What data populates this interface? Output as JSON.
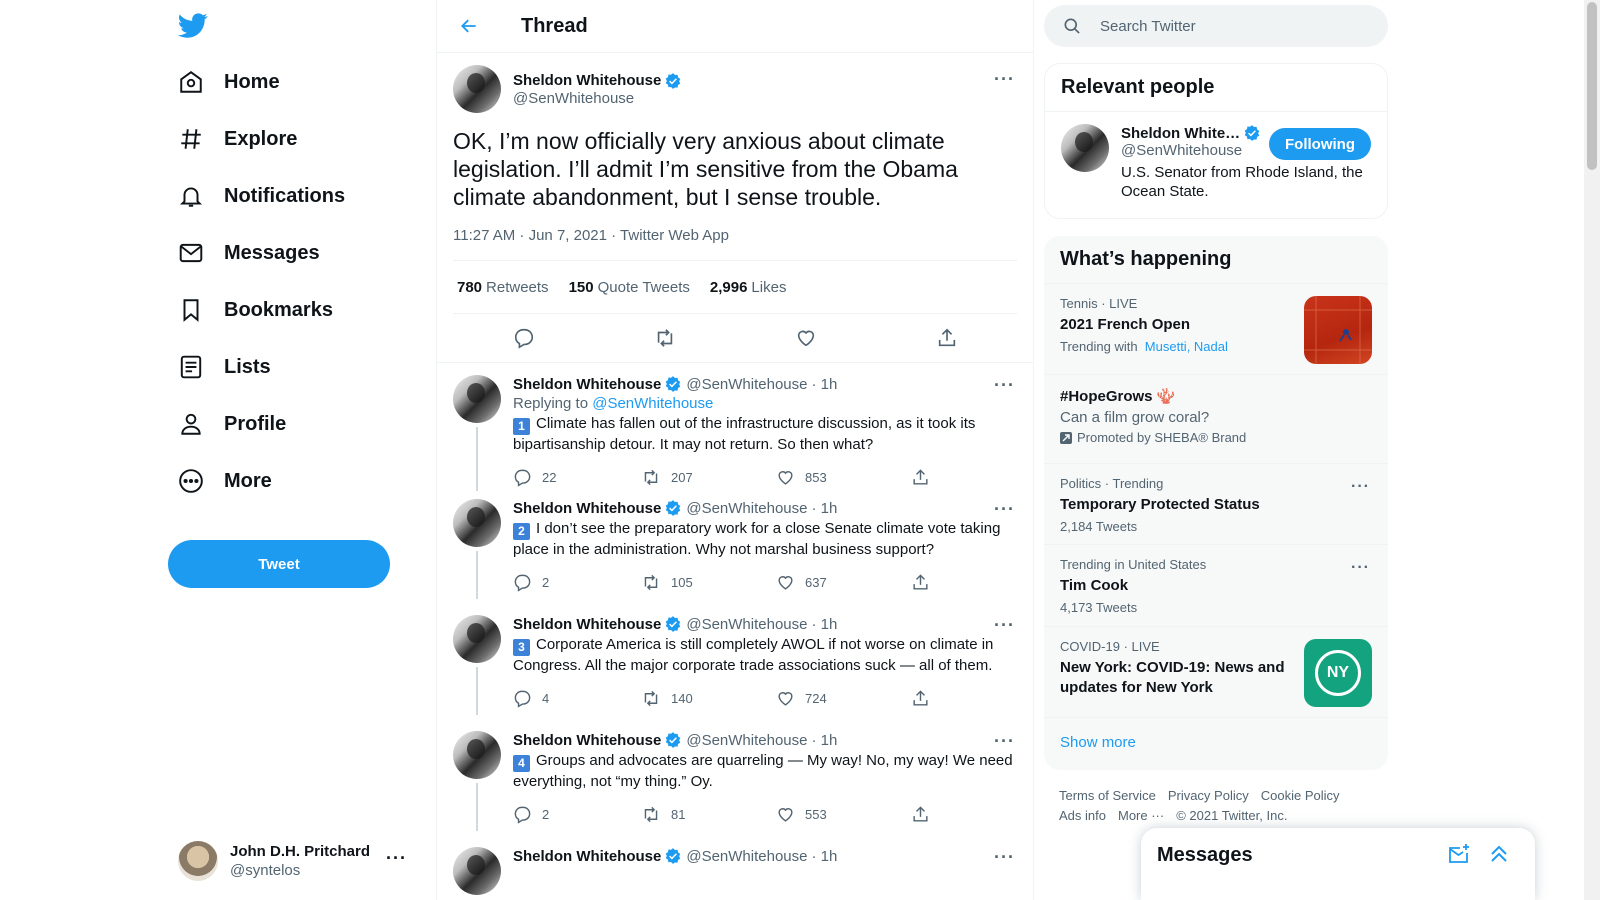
{
  "nav": {
    "logo_icon": "twitter-bird-icon",
    "items": [
      {
        "label": "Home",
        "icon": "home-icon"
      },
      {
        "label": "Explore",
        "icon": "hashtag-icon"
      },
      {
        "label": "Notifications",
        "icon": "bell-icon"
      },
      {
        "label": "Messages",
        "icon": "envelope-icon"
      },
      {
        "label": "Bookmarks",
        "icon": "bookmark-icon"
      },
      {
        "label": "Lists",
        "icon": "list-icon"
      },
      {
        "label": "Profile",
        "icon": "person-icon"
      },
      {
        "label": "More",
        "icon": "more-circle-icon"
      }
    ],
    "tweet_button": "Tweet",
    "account": {
      "name": "John D.H. Pritchard",
      "handle": "@syntelos",
      "more": "···"
    }
  },
  "header": {
    "title": "Thread"
  },
  "main_tweet": {
    "name": "Sheldon Whitehouse",
    "handle": "@SenWhitehouse",
    "text": "OK, I’m now officially very anxious about climate legislation. I’ll admit I’m sensitive from the Obama climate abandonment, but I sense trouble.",
    "meta": "11:27 AM · Jun 7, 2021 · Twitter Web App",
    "retweets_num": "780",
    "retweets_label": "Retweets",
    "quotes_num": "150",
    "quotes_label": "Quote Tweets",
    "likes_num": "2,996",
    "likes_label": "Likes"
  },
  "replies": [
    {
      "name": "Sheldon Whitehouse",
      "handle": "@SenWhitehouse",
      "time": "· 1h",
      "replying_prefix": "Replying to",
      "replying_to": "@SenWhitehouse",
      "keycap": "1",
      "text": "Climate has fallen out of the infrastructure discussion, as it took its bipartisanship detour. It may not return. So then what?",
      "replies": "22",
      "retweets": "207",
      "likes": "853"
    },
    {
      "name": "Sheldon Whitehouse",
      "handle": "@SenWhitehouse",
      "time": "· 1h",
      "keycap": "2",
      "text": "I don’t see the preparatory work for a close Senate climate vote taking place in the administration. Why not marshal business support?",
      "replies": "2",
      "retweets": "105",
      "likes": "637"
    },
    {
      "name": "Sheldon Whitehouse",
      "handle": "@SenWhitehouse",
      "time": "· 1h",
      "keycap": "3",
      "text": "Corporate America is still completely AWOL if not worse on climate in Congress. All the major corporate trade associations suck — all of them.",
      "replies": "4",
      "retweets": "140",
      "likes": "724"
    },
    {
      "name": "Sheldon Whitehouse",
      "handle": "@SenWhitehouse",
      "time": "· 1h",
      "keycap": "4",
      "text": "Groups and advocates are quarreling — My way! No, my way! We need everything, not “my thing.” Oy.",
      "replies": "2",
      "retweets": "81",
      "likes": "553"
    },
    {
      "name": "Sheldon Whitehouse",
      "handle": "@SenWhitehouse",
      "time": "· 1h"
    }
  ],
  "search": {
    "placeholder": "Search Twitter"
  },
  "relevant": {
    "title": "Relevant people",
    "name": "Sheldon White…",
    "handle": "@SenWhitehouse",
    "button": "Following",
    "bio": "U.S. Senator from Rhode Island, the Ocean State."
  },
  "happening": {
    "title": "What’s happening",
    "trends": [
      {
        "context": "Tennis · LIVE",
        "title": "2021 French Open",
        "sub_prefix": "Trending with",
        "sub_links": "Musetti, Nadal"
      },
      {
        "title": "#HopeGrows",
        "emoji": "🪸",
        "sub_text": "Can a film grow coral?",
        "promoted": "Promoted by SHEBA® Brand"
      },
      {
        "context": "Politics · Trending",
        "title": "Temporary Protected Status",
        "count": "2,184 Tweets"
      },
      {
        "context": "Trending in United States",
        "title": "Tim Cook",
        "count": "4,173 Tweets"
      },
      {
        "context": "COVID-19 · LIVE",
        "title": "New York: COVID-19: News and updates for New York",
        "badge": "NY"
      }
    ],
    "show_more": "Show more"
  },
  "footer": {
    "links": [
      "Terms of Service",
      "Privacy Policy",
      "Cookie Policy",
      "Ads info",
      "More ···"
    ],
    "copyright": "© 2021 Twitter, Inc."
  },
  "messages_dock": {
    "title": "Messages"
  },
  "colors": {
    "accent": "#1d9bf0",
    "text": "#0f1419",
    "muted": "#536471"
  }
}
